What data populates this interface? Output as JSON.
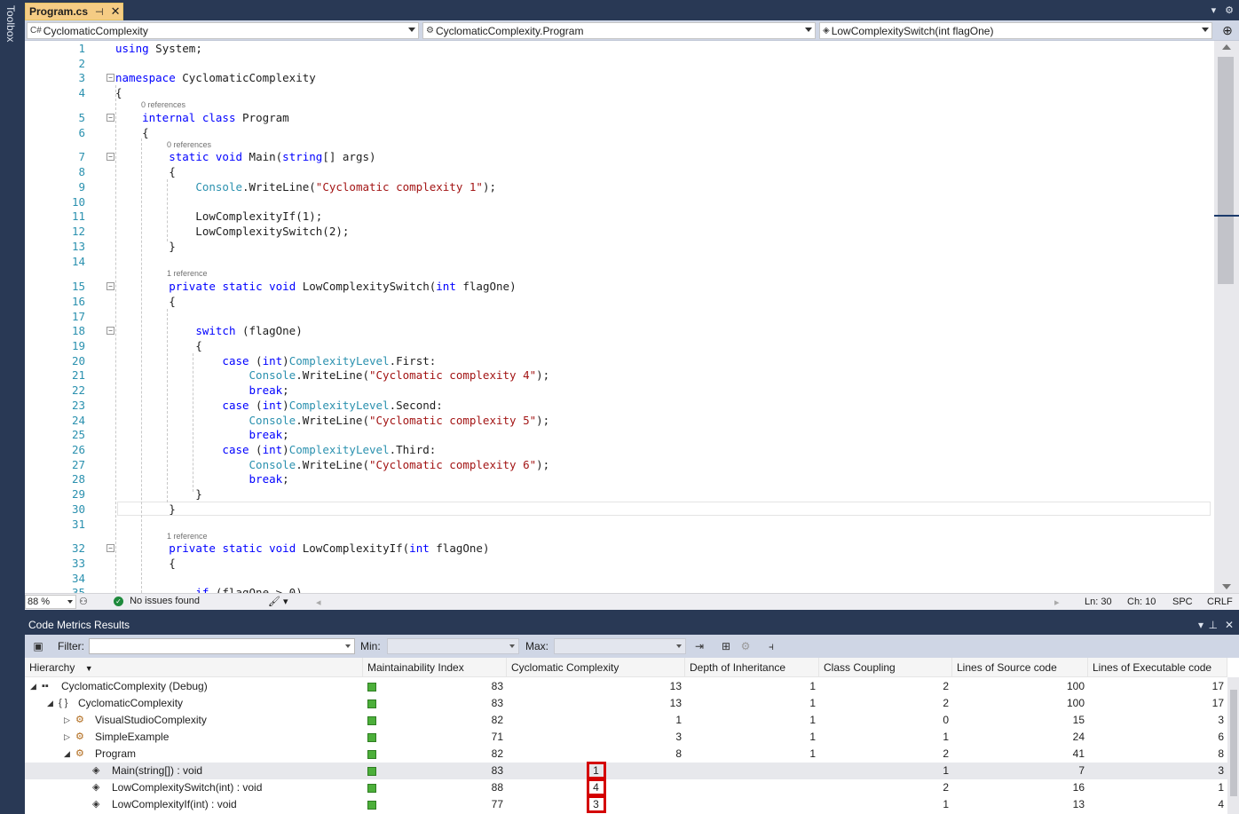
{
  "toolbox": {
    "label": "Toolbox"
  },
  "tab": {
    "name": "Program.cs",
    "pin": "⊣",
    "close": "✕"
  },
  "navbar": {
    "project": "CyclomaticComplexity",
    "type": "CyclomaticComplexity.Program",
    "member": "LowComplexitySwitch(int flagOne)"
  },
  "code": {
    "lines": [
      {
        "n": "1",
        "text": "using System;"
      },
      {
        "n": "2",
        "text": ""
      },
      {
        "n": "3",
        "text": "namespace CyclomaticComplexity"
      },
      {
        "n": "4",
        "text": "{"
      },
      {
        "n": "5",
        "text": "    internal class Program"
      },
      {
        "n": "6",
        "text": "    {"
      },
      {
        "n": "7",
        "text": "        static void Main(string[] args)"
      },
      {
        "n": "8",
        "text": "        {"
      },
      {
        "n": "9",
        "text": "            Console.WriteLine(\"Cyclomatic complexity 1\");"
      },
      {
        "n": "10",
        "text": ""
      },
      {
        "n": "11",
        "text": "            LowComplexityIf(1);"
      },
      {
        "n": "12",
        "text": "            LowComplexitySwitch(2);"
      },
      {
        "n": "13",
        "text": "        }"
      },
      {
        "n": "14",
        "text": ""
      },
      {
        "n": "15",
        "text": "        private static void LowComplexitySwitch(int flagOne)"
      },
      {
        "n": "16",
        "text": "        {"
      },
      {
        "n": "17",
        "text": ""
      },
      {
        "n": "18",
        "text": "            switch (flagOne)"
      },
      {
        "n": "19",
        "text": "            {"
      },
      {
        "n": "20",
        "text": "                case (int)ComplexityLevel.First:"
      },
      {
        "n": "21",
        "text": "                    Console.WriteLine(\"Cyclomatic complexity 4\");"
      },
      {
        "n": "22",
        "text": "                    break;"
      },
      {
        "n": "23",
        "text": "                case (int)ComplexityLevel.Second:"
      },
      {
        "n": "24",
        "text": "                    Console.WriteLine(\"Cyclomatic complexity 5\");"
      },
      {
        "n": "25",
        "text": "                    break;"
      },
      {
        "n": "26",
        "text": "                case (int)ComplexityLevel.Third:"
      },
      {
        "n": "27",
        "text": "                    Console.WriteLine(\"Cyclomatic complexity 6\");"
      },
      {
        "n": "28",
        "text": "                    break;"
      },
      {
        "n": "29",
        "text": "            }"
      },
      {
        "n": "30",
        "text": "        }"
      },
      {
        "n": "31",
        "text": ""
      },
      {
        "n": "32",
        "text": "        private static void LowComplexityIf(int flagOne)"
      },
      {
        "n": "33",
        "text": "        {"
      },
      {
        "n": "34",
        "text": ""
      },
      {
        "n": "35",
        "text": "            if (flagOne > 0)"
      }
    ],
    "lens": [
      "0 references",
      "0 references",
      "1 reference",
      "1 reference"
    ]
  },
  "editor_status": {
    "zoom": "88 %",
    "issues": "No issues found",
    "ln": "Ln: 30",
    "ch": "Ch: 10",
    "spc": "SPC",
    "eol": "CRLF"
  },
  "metrics": {
    "title": "Code Metrics Results",
    "toolbar": {
      "filter_label": "Filter:",
      "min_label": "Min:",
      "max_label": "Max:"
    },
    "columns": [
      "Hierarchy",
      "Maintainability Index",
      "Cyclomatic Complexity",
      "Depth of Inheritance",
      "Class Coupling",
      "Lines of Source code",
      "Lines of Executable code"
    ],
    "rows": [
      {
        "name": "CyclomaticComplexity (Debug)",
        "mi": "83",
        "cc": "13",
        "doi": "1",
        "coup": "2",
        "src": "100",
        "exe": "17"
      },
      {
        "name": "CyclomaticComplexity",
        "mi": "83",
        "cc": "13",
        "doi": "1",
        "coup": "2",
        "src": "100",
        "exe": "17"
      },
      {
        "name": "VisualStudioComplexity",
        "mi": "82",
        "cc": "1",
        "doi": "1",
        "coup": "0",
        "src": "15",
        "exe": "3"
      },
      {
        "name": "SimpleExample",
        "mi": "71",
        "cc": "3",
        "doi": "1",
        "coup": "1",
        "src": "24",
        "exe": "6"
      },
      {
        "name": "Program",
        "mi": "82",
        "cc": "8",
        "doi": "1",
        "coup": "2",
        "src": "41",
        "exe": "8"
      },
      {
        "name": "Main(string[]) : void",
        "mi": "83",
        "cc": "1",
        "doi": "",
        "coup": "1",
        "src": "7",
        "exe": "3"
      },
      {
        "name": "LowComplexitySwitch(int) : void",
        "mi": "88",
        "cc": "4",
        "doi": "",
        "coup": "2",
        "src": "16",
        "exe": "1"
      },
      {
        "name": "LowComplexityIf(int) : void",
        "mi": "77",
        "cc": "3",
        "doi": "",
        "coup": "1",
        "src": "13",
        "exe": "4"
      }
    ]
  },
  "colors": {
    "highlight_box": "#d40000",
    "mi_good": "#4caf3a",
    "tab_active": "#f5cc84"
  }
}
